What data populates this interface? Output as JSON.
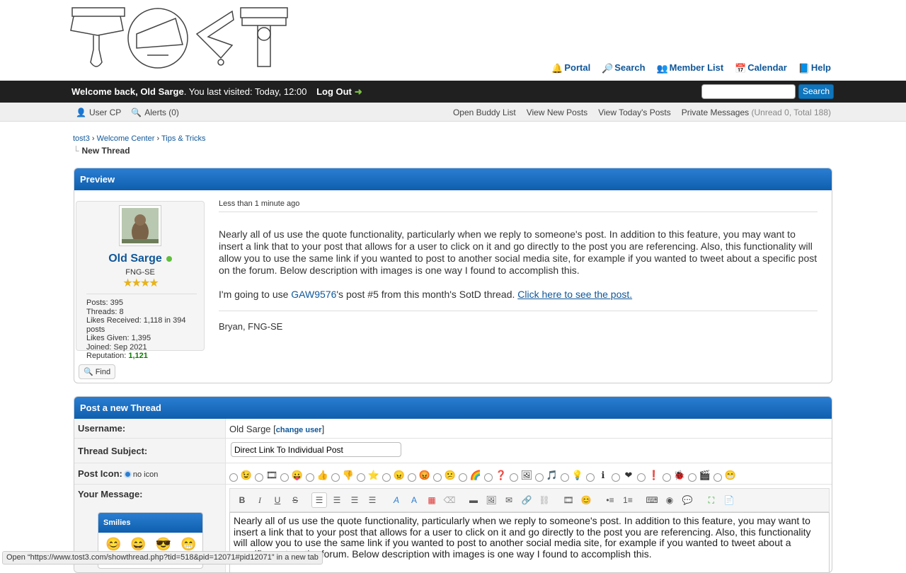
{
  "header": {
    "links": [
      {
        "label": "Portal",
        "icon": "portal-icon"
      },
      {
        "label": "Search",
        "icon": "search-icon"
      },
      {
        "label": "Member List",
        "icon": "members-icon"
      },
      {
        "label": "Calendar",
        "icon": "calendar-icon"
      },
      {
        "label": "Help",
        "icon": "help-icon"
      }
    ]
  },
  "navbar": {
    "welcome_prefix": "Welcome back, ",
    "username": "Old Sarge",
    "visited": ". You last visited: Today, 12:00",
    "logout": "Log Out",
    "search_button": "Search",
    "search_value": ""
  },
  "subbar": {
    "user_cp": "User CP",
    "alerts": "Alerts (0)",
    "buddy": "Open Buddy List",
    "new_posts": "View New Posts",
    "todays_posts": "View Today's Posts",
    "pm": "Private Messages",
    "pm_counts": "(Unread 0, Total 188)"
  },
  "breadcrumb": {
    "items": [
      "tost3",
      "Welcome Center",
      "Tips & Tricks"
    ],
    "separator": "›",
    "current": "New Thread"
  },
  "preview": {
    "heading": "Preview",
    "author": {
      "name": "Old Sarge",
      "title": "FNG-SE",
      "stars": "★★★★",
      "posts": "Posts: 395",
      "threads": "Threads: 8",
      "likes_received": "Likes Received: 1,118 in 394 posts",
      "likes_given": "Likes Given: 1,395",
      "joined": "Joined: Sep 2021",
      "reputation_label": "Reputation: ",
      "reputation": "1,121"
    },
    "time": "Less than 1 minute ago",
    "p1": "Nearly all of us use the quote functionality, particularly when we reply to someone's post. In addition to this feature, you may want to insert a link that to your post that allows for a user to click on it and go directly to the post you are referencing. Also, this functionality will allow you to use the same link if you wanted to post to another social media site, for example if you wanted to tweet about a specific post on the forum. Below description with images is one way I found to accomplish this.",
    "p2_prefix": "I'm going to use ",
    "p2_user": "GAW9576",
    "p2_mid": "'s post #5 from this month's SotD thread. ",
    "p2_link": "Click here to see the post.",
    "signature": "Bryan, FNG-SE",
    "find": "Find"
  },
  "form": {
    "heading": "Post a new Thread",
    "username_label": "Username:",
    "username_value": "Old Sarge",
    "change_user": "change user",
    "subject_label": "Thread Subject:",
    "subject_value": "Direct Link To Individual Post",
    "icon_label": "Post Icon:",
    "no_icon": "no icon",
    "post_icons": [
      "😉",
      "🎞",
      "😛",
      "👍",
      "👎",
      "⭐",
      "😠",
      "😡",
      "😕",
      "🌈",
      "❓",
      "🖼",
      "🎵",
      "💡",
      "ℹ",
      "❤",
      "❗",
      "🐞",
      "🎬",
      "😁"
    ],
    "message_label": "Your Message:",
    "message_value": "Nearly all of us use the quote functionality, particularly when we reply to someone's post. In addition to this feature, you may want to insert a link that to your post that allows for a user to click on it and go directly to the post you are referencing. Also, this functionality will allow you to use the same link if you wanted to post to another social media site, for example if you wanted to tweet about a specific post on the forum. Below description with images is one way I found to accomplish this.",
    "smilies_heading": "Smilies",
    "smilies": [
      "😊",
      "😄",
      "😎",
      "😁"
    ]
  },
  "statusbar": "Open “https://www.tost3.com/showthread.php?tid=518&pid=12071#pid12071” in a new tab"
}
